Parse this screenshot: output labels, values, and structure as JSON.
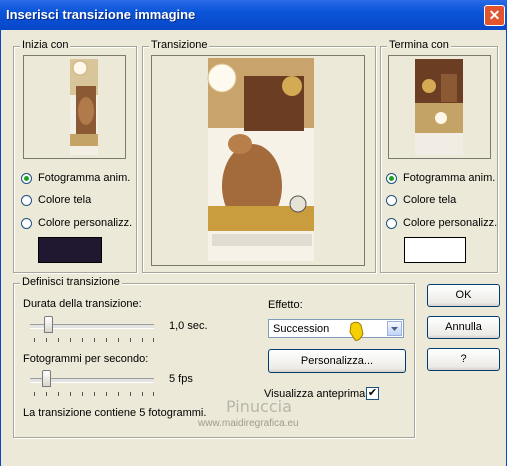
{
  "window": {
    "title": "Inserisci transizione immagine",
    "close_glyph": "✕"
  },
  "start": {
    "legend": "Inizia con",
    "options": [
      "Fotogramma anim.",
      "Colore tela",
      "Colore personalizz."
    ],
    "selected": 0,
    "custom_color": "#201830"
  },
  "transition": {
    "legend": "Transizione"
  },
  "end": {
    "legend": "Termina con",
    "options": [
      "Fotogramma anim.",
      "Colore tela",
      "Colore personalizz."
    ],
    "selected": 0,
    "custom_color": "#ffffff"
  },
  "define": {
    "legend": "Definisci transizione",
    "duration_label": "Durata della transizione:",
    "duration_value": "1,0 sec.",
    "fps_label": "Fotogrammi per secondo:",
    "fps_value": "5 fps",
    "info": "La transizione contiene 5 fotogrammi.",
    "effect_label": "Effetto:",
    "effect_value": "Succession",
    "customize_label": "Personalizza...",
    "preview_label": "Visualizza anteprima",
    "preview_checked": true
  },
  "buttons": {
    "ok": "OK",
    "cancel": "Annulla",
    "help": "?"
  },
  "watermark": {
    "line1": "Pinuccia",
    "line2": "www.maidiregrafica.eu"
  }
}
